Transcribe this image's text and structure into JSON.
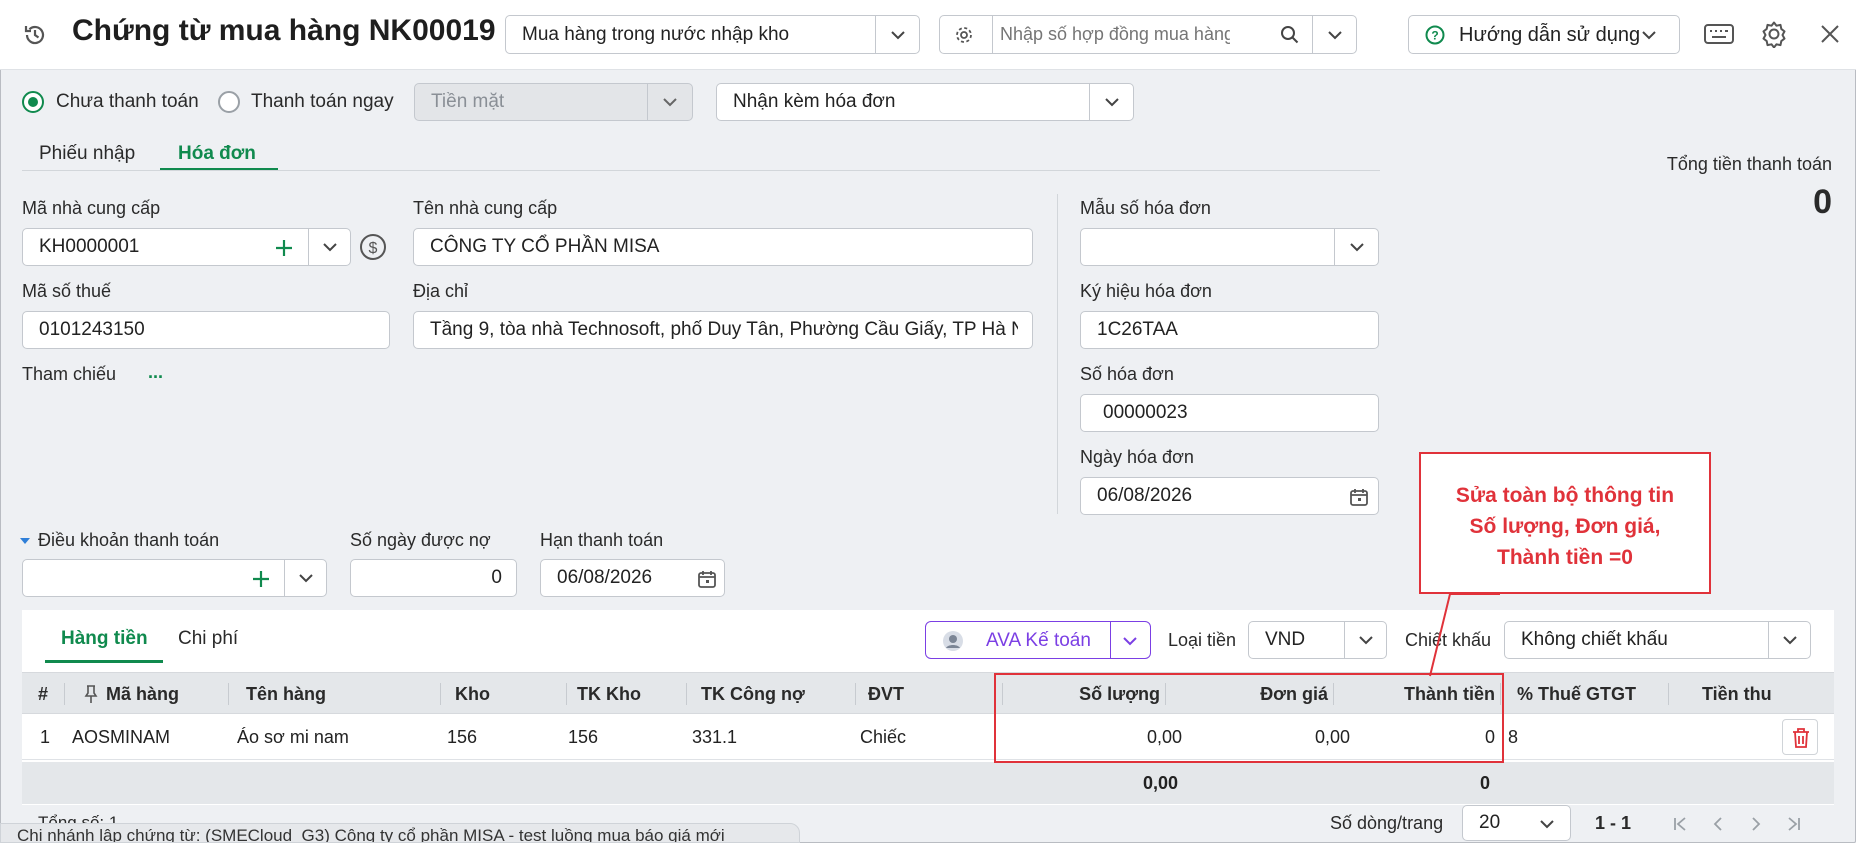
{
  "header": {
    "title": "Chứng từ mua hàng NK00019",
    "type_select": "Mua hàng trong nước nhập kho",
    "contract_placeholder": "Nhập số hợp đồng mua hàng",
    "help_label": "Hướng dẫn sử dụng"
  },
  "payment": {
    "unpaid_label": "Chưa thanh toán",
    "pay_now_label": "Thanh toán ngay",
    "method": "Tiền mặt",
    "invoice_option": "Nhận kèm hóa đơn"
  },
  "tabs": [
    {
      "label": "Phiếu nhập",
      "active": false
    },
    {
      "label": "Hóa đơn",
      "active": true
    }
  ],
  "total": {
    "label": "Tổng tiền thanh toán",
    "value": "0"
  },
  "supplier": {
    "code_label": "Mã nhà cung cấp",
    "code": "KH0000001",
    "name_label": "Tên nhà cung cấp",
    "name": "CÔNG TY CỔ PHẦN MISA",
    "tax_label": "Mã số thuế",
    "tax": "0101243150",
    "address_label": "Địa chỉ",
    "address": "Tầng 9, tòa nhà Technosoft, phố Duy Tân, Phường Cầu Giấy, TP Hà N",
    "ref_label": "Tham chiếu",
    "ref_more": "..."
  },
  "invoice": {
    "template_label": "Mẫu số hóa đơn",
    "template": "",
    "symbol_label": "Ký hiệu hóa đơn",
    "symbol": "1C26TAA",
    "number_label": "Số hóa đơn",
    "number": "00000023",
    "date_label": "Ngày hóa đơn",
    "date": "06/08/2026"
  },
  "terms": {
    "terms_label": "Điều khoản thanh toán",
    "terms": "",
    "days_label": "Số ngày được nợ",
    "days": "0",
    "due_label": "Hạn thanh toán",
    "due": "06/08/2026"
  },
  "annotation": {
    "line1": "Sửa toàn bộ thông tin",
    "line2": "Số lượng, Đơn giá,",
    "line3": "Thành tiền =0",
    "color": "#e0323a"
  },
  "detail": {
    "tabs": [
      {
        "label": "Hàng tiền",
        "active": true
      },
      {
        "label": "Chi phí",
        "active": false
      }
    ],
    "ava_label": "AVA Kế toán",
    "currency_label": "Loại tiền",
    "currency": "VND",
    "discount_label": "Chiết khấu",
    "discount": "Không chiết khấu",
    "columns": [
      "#",
      "Mã hàng",
      "Tên hàng",
      "Kho",
      "TK Kho",
      "TK Công nợ",
      "ĐVT",
      "Số lượng",
      "Đơn giá",
      "Thành tiền",
      "% Thuế GTGT",
      "Tiền thu"
    ],
    "rows": [
      {
        "no": "1",
        "code": "AOSMINAM",
        "name": "Áo sơ mi nam",
        "warehouse": "156",
        "wh_account": "156",
        "debt_account": "331.1",
        "unit": "Chiếc",
        "qty": "0,00",
        "price": "0,00",
        "amount": "0",
        "vat": "8",
        "collected": ""
      }
    ],
    "totals": {
      "qty": "0,00",
      "amount": "0"
    }
  },
  "footer": {
    "count_label": "Tổng số: 1",
    "branch_text": "Chi nhánh lập chứng từ: (SMECloud_G3) Công ty cổ phần MISA - test luồng mua báo giá mới",
    "rows_per_page_label": "Số dòng/trang",
    "rows_per_page": "20",
    "range": "1 - 1"
  },
  "colors": {
    "accent": "#108a4e",
    "alert": "#e0323a",
    "ava": "#7b3fe4"
  }
}
